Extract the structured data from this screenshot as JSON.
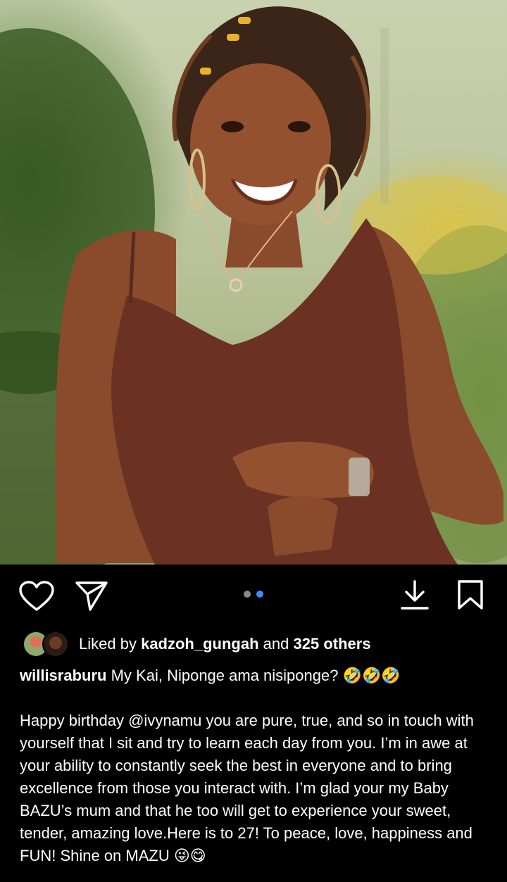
{
  "post": {
    "likes": {
      "prefix": "Liked by",
      "user": "kadzoh_gungah",
      "conjunction": "and",
      "others": "325 others"
    },
    "caption": {
      "username": "willisraburu",
      "line1": "My Kai, Niponge ama nisiponge? 🤣🤣🤣",
      "body_before": "Happy birthday ",
      "mention": "@ivynamu",
      "body_after": " you are pure, true, and so in touch with yourself that I sit and try to learn each day from you. I’m in awe at your ability to constantly seek the best in everyone and to bring excellence from those you interact with. I’m glad your my Baby BAZU’s mum and that he too will get to experience your sweet, tender, amazing love.Here is to 27! To peace, love, happiness and FUN! Shine on MAZU 😜😋"
    },
    "carousel": {
      "current": 2,
      "total": 2
    },
    "icons": [
      "heart-icon",
      "send-icon",
      "download-icon",
      "bookmark-icon"
    ]
  }
}
